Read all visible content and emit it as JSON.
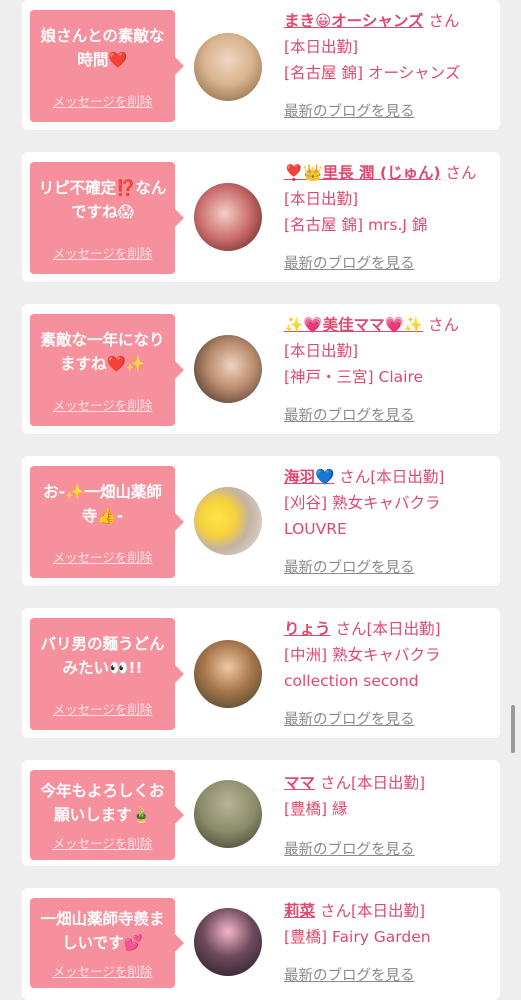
{
  "colors": {
    "bubble": "#f6909d",
    "accent": "#e0486e",
    "link_gray": "#8a8a8a",
    "background": "#eeeeee"
  },
  "cards": [
    {
      "message": "娘さんとの素敵な時間❤️",
      "delete_label": "メッセージを削除",
      "avatar_icon": "photo-avatar",
      "name": "まき😀オーシャンズ",
      "suffix": "さん",
      "lines": [
        "[本日出勤]",
        "[名古屋 錦] オーシャンズ"
      ],
      "blog_label": "最新のブログを見る"
    },
    {
      "message": "リピ不確定⁉️なんですね😱",
      "delete_label": "メッセージを削除",
      "avatar_icon": "photo-avatar",
      "name": "❣️👑里長 潤 (じゅん)",
      "suffix": "さん",
      "lines": [
        "[本日出勤]",
        "[名古屋 錦] mrs.J 錦"
      ],
      "blog_label": "最新のブログを見る"
    },
    {
      "message": "素敵な一年になりますね❤️✨",
      "delete_label": "メッセージを削除",
      "avatar_icon": "photo-avatar",
      "name": "✨💗美佳ママ💗✨",
      "suffix": "さん",
      "lines": [
        "[本日出勤]",
        "[神戸・三宮] Claire"
      ],
      "blog_label": "最新のブログを見る"
    },
    {
      "message": "お-✨一畑山薬師寺👍-",
      "delete_label": "メッセージを削除",
      "avatar_icon": "photo-avatar",
      "name": "海羽💙",
      "suffix": "さん[本日出勤]",
      "lines": [
        "[刈谷] 熟女キャバクラ",
        "LOUVRE"
      ],
      "blog_label": "最新のブログを見る"
    },
    {
      "message": "バリ男の麺うどんみたい👀!!",
      "delete_label": "メッセージを削除",
      "avatar_icon": "photo-avatar",
      "name": "りょう",
      "suffix": "さん[本日出勤]",
      "lines": [
        "[中洲] 熟女キャバクラ",
        "collection second"
      ],
      "blog_label": "最新のブログを見る"
    },
    {
      "message": "今年もよろしくお願いします🎍",
      "delete_label": "メッセージを削除",
      "avatar_icon": "photo-avatar",
      "name": "ママ",
      "suffix": "さん[本日出勤]",
      "lines": [
        "[豊橋] 縁"
      ],
      "blog_label": "最新のブログを見る"
    },
    {
      "message": "一畑山薬師寺羨ましいです💕",
      "delete_label": "メッセージを削除",
      "avatar_icon": "photo-avatar",
      "name": "莉菜",
      "suffix": "さん[本日出勤]",
      "lines": [
        "[豊橋] Fairy Garden"
      ],
      "blog_label": "最新のブログを見る"
    }
  ]
}
